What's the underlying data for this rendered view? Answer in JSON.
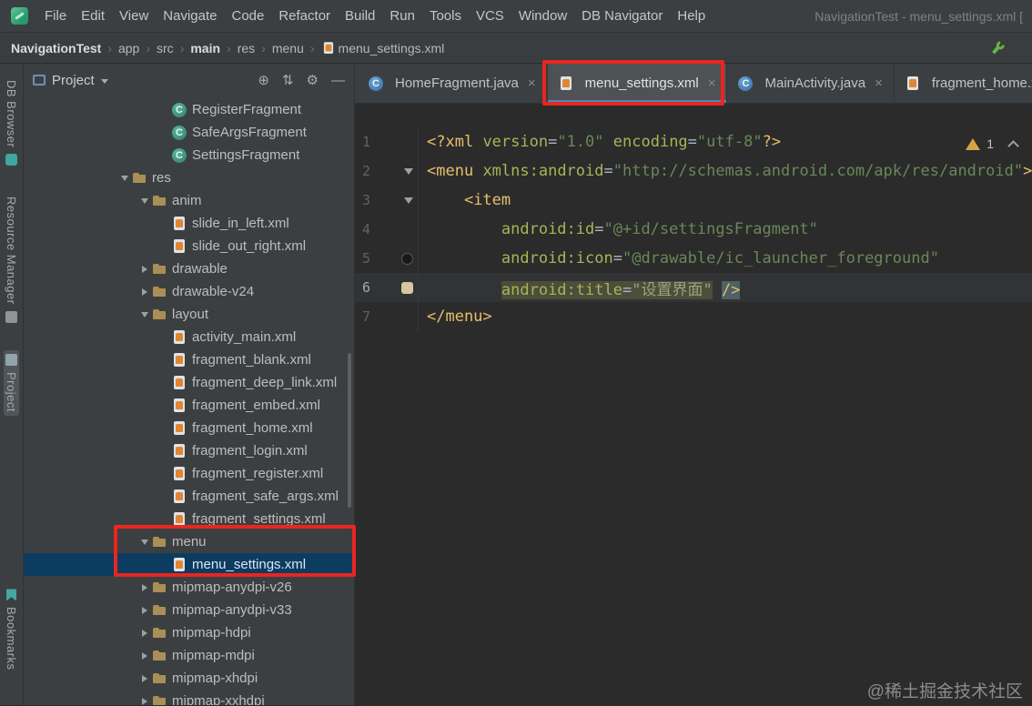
{
  "window": {
    "title_right": "NavigationTest - menu_settings.xml ["
  },
  "menubar": {
    "items": [
      "File",
      "Edit",
      "View",
      "Navigate",
      "Code",
      "Refactor",
      "Build",
      "Run",
      "Tools",
      "VCS",
      "Window",
      "DB Navigator",
      "Help"
    ]
  },
  "breadcrumb": {
    "items": [
      {
        "label": "NavigationTest",
        "bold": true
      },
      {
        "label": "app"
      },
      {
        "label": "src"
      },
      {
        "label": "main",
        "bold": true
      },
      {
        "label": "res"
      },
      {
        "label": "menu"
      },
      {
        "label": "menu_settings.xml",
        "icon": "android-xml-file-icon"
      }
    ]
  },
  "tool_strip": {
    "top": [
      {
        "label": "DB Browser",
        "icon": "db-browser-icon",
        "icon_first": false
      },
      {
        "label": "Resource Manager",
        "icon": "resource-manager-icon",
        "icon_first": false
      },
      {
        "label": "Project",
        "icon": "project-icon",
        "icon_first": true,
        "active": true
      }
    ],
    "bottom": [
      {
        "label": "Bookmarks",
        "icon": "bookmarks-icon",
        "icon_first": true
      }
    ]
  },
  "project_panel": {
    "title": "Project",
    "header_icons": [
      {
        "name": "locate-icon",
        "glyph": "⊕"
      },
      {
        "name": "collapse-all-icon",
        "glyph": "⇅"
      },
      {
        "name": "settings-gear-icon",
        "glyph": "⚙"
      },
      {
        "name": "hide-panel-icon",
        "glyph": "—"
      }
    ],
    "tree": [
      {
        "label": "RegisterFragment",
        "depth": 6,
        "kind": "class",
        "state": "leaf"
      },
      {
        "label": "SafeArgsFragment",
        "depth": 6,
        "kind": "class",
        "state": "leaf"
      },
      {
        "label": "SettingsFragment",
        "depth": 6,
        "kind": "class",
        "state": "leaf"
      },
      {
        "label": "res",
        "depth": 4,
        "kind": "folder",
        "state": "open"
      },
      {
        "label": "anim",
        "depth": 5,
        "kind": "folder",
        "state": "open"
      },
      {
        "label": "slide_in_left.xml",
        "depth": 6,
        "kind": "xml",
        "state": "leaf"
      },
      {
        "label": "slide_out_right.xml",
        "depth": 6,
        "kind": "xml",
        "state": "leaf"
      },
      {
        "label": "drawable",
        "depth": 5,
        "kind": "folder",
        "state": "closed"
      },
      {
        "label": "drawable-v24",
        "depth": 5,
        "kind": "folder",
        "state": "closed"
      },
      {
        "label": "layout",
        "depth": 5,
        "kind": "folder",
        "state": "open"
      },
      {
        "label": "activity_main.xml",
        "depth": 6,
        "kind": "xml",
        "state": "leaf"
      },
      {
        "label": "fragment_blank.xml",
        "depth": 6,
        "kind": "xml",
        "state": "leaf"
      },
      {
        "label": "fragment_deep_link.xml",
        "depth": 6,
        "kind": "xml",
        "state": "leaf"
      },
      {
        "label": "fragment_embed.xml",
        "depth": 6,
        "kind": "xml",
        "state": "leaf"
      },
      {
        "label": "fragment_home.xml",
        "depth": 6,
        "kind": "xml",
        "state": "leaf"
      },
      {
        "label": "fragment_login.xml",
        "depth": 6,
        "kind": "xml",
        "state": "leaf"
      },
      {
        "label": "fragment_register.xml",
        "depth": 6,
        "kind": "xml",
        "state": "leaf"
      },
      {
        "label": "fragment_safe_args.xml",
        "depth": 6,
        "kind": "xml",
        "state": "leaf"
      },
      {
        "label": "fragment_settings.xml",
        "depth": 6,
        "kind": "xml",
        "state": "leaf"
      },
      {
        "label": "menu",
        "depth": 5,
        "kind": "folder",
        "state": "open"
      },
      {
        "label": "menu_settings.xml",
        "depth": 6,
        "kind": "xml",
        "state": "leaf",
        "selected": true
      },
      {
        "label": "mipmap-anydpi-v26",
        "depth": 5,
        "kind": "folder",
        "state": "closed"
      },
      {
        "label": "mipmap-anydpi-v33",
        "depth": 5,
        "kind": "folder",
        "state": "closed"
      },
      {
        "label": "mipmap-hdpi",
        "depth": 5,
        "kind": "folder",
        "state": "closed"
      },
      {
        "label": "mipmap-mdpi",
        "depth": 5,
        "kind": "folder",
        "state": "closed"
      },
      {
        "label": "mipmap-xhdpi",
        "depth": 5,
        "kind": "folder",
        "state": "closed"
      },
      {
        "label": "mipmap-xxhdpi",
        "depth": 5,
        "kind": "folder",
        "state": "closed"
      }
    ]
  },
  "editor": {
    "tabs": [
      {
        "label": "HomeFragment.java",
        "icon": "java-class",
        "close": "×"
      },
      {
        "label": "menu_settings.xml",
        "icon": "android-xml",
        "close": "×",
        "selected": true
      },
      {
        "label": "MainActivity.java",
        "icon": "java-class",
        "close": "×"
      },
      {
        "label": "fragment_home.xml",
        "icon": "android-xml"
      }
    ],
    "inspection": {
      "warning_count": "1"
    },
    "lines": [
      {
        "num": "1",
        "segments": [
          {
            "t": "<?xml",
            "c": "tag"
          },
          {
            "t": " ",
            "c": "plain"
          },
          {
            "t": "version",
            "c": "attr"
          },
          {
            "t": "=",
            "c": "plain"
          },
          {
            "t": "\"1.0\"",
            "c": "str"
          },
          {
            "t": " ",
            "c": "plain"
          },
          {
            "t": "encoding",
            "c": "attr"
          },
          {
            "t": "=",
            "c": "plain"
          },
          {
            "t": "\"utf-8\"",
            "c": "str"
          },
          {
            "t": "?>",
            "c": "tag"
          }
        ]
      },
      {
        "num": "2",
        "gutter": "fold",
        "segments": [
          {
            "t": "<menu",
            "c": "tag"
          },
          {
            "t": " ",
            "c": "plain"
          },
          {
            "t": "xmlns:android",
            "c": "attr"
          },
          {
            "t": "=",
            "c": "plain"
          },
          {
            "t": "\"http://schemas.android.com/apk/res/android\"",
            "c": "str"
          },
          {
            "t": ">",
            "c": "tag"
          }
        ]
      },
      {
        "num": "3",
        "gutter": "fold",
        "segments": [
          {
            "t": "    ",
            "c": "plain"
          },
          {
            "t": "<item",
            "c": "tag"
          }
        ]
      },
      {
        "num": "4",
        "segments": [
          {
            "t": "        ",
            "c": "plain"
          },
          {
            "t": "android:id",
            "c": "attr"
          },
          {
            "t": "=",
            "c": "plain"
          },
          {
            "t": "\"@+id/settingsFragment\"",
            "c": "str"
          }
        ]
      },
      {
        "num": "5",
        "gutter": "circle",
        "segments": [
          {
            "t": "        ",
            "c": "plain"
          },
          {
            "t": "android:icon",
            "c": "attr"
          },
          {
            "t": "=",
            "c": "plain"
          },
          {
            "t": "\"@drawable/ic_launcher_foreground\"",
            "c": "str"
          }
        ]
      },
      {
        "num": "6",
        "gutter": "beige",
        "current": true,
        "segments": [
          {
            "t": "        ",
            "c": "plain"
          },
          {
            "t": "android:title",
            "c": "attr",
            "hl": true
          },
          {
            "t": "=",
            "c": "plain",
            "hl": true
          },
          {
            "t": "\"设置界面\"",
            "c": "strdim",
            "hl": true
          },
          {
            "t": " ",
            "c": "plain"
          },
          {
            "t": "/>",
            "c": "tag",
            "box": true
          }
        ]
      },
      {
        "num": "7",
        "segments": [
          {
            "t": "</menu>",
            "c": "tag"
          }
        ]
      }
    ]
  },
  "watermark": "@稀土掘金技术社区",
  "colors": {
    "selection_blue": "#0d3c61",
    "annotation_red": "#e8261f",
    "tab_underline": "#4a88c7",
    "warning_yellow": "#d9a343",
    "tag": "#e8bf6a",
    "string_green": "#6a8759"
  }
}
